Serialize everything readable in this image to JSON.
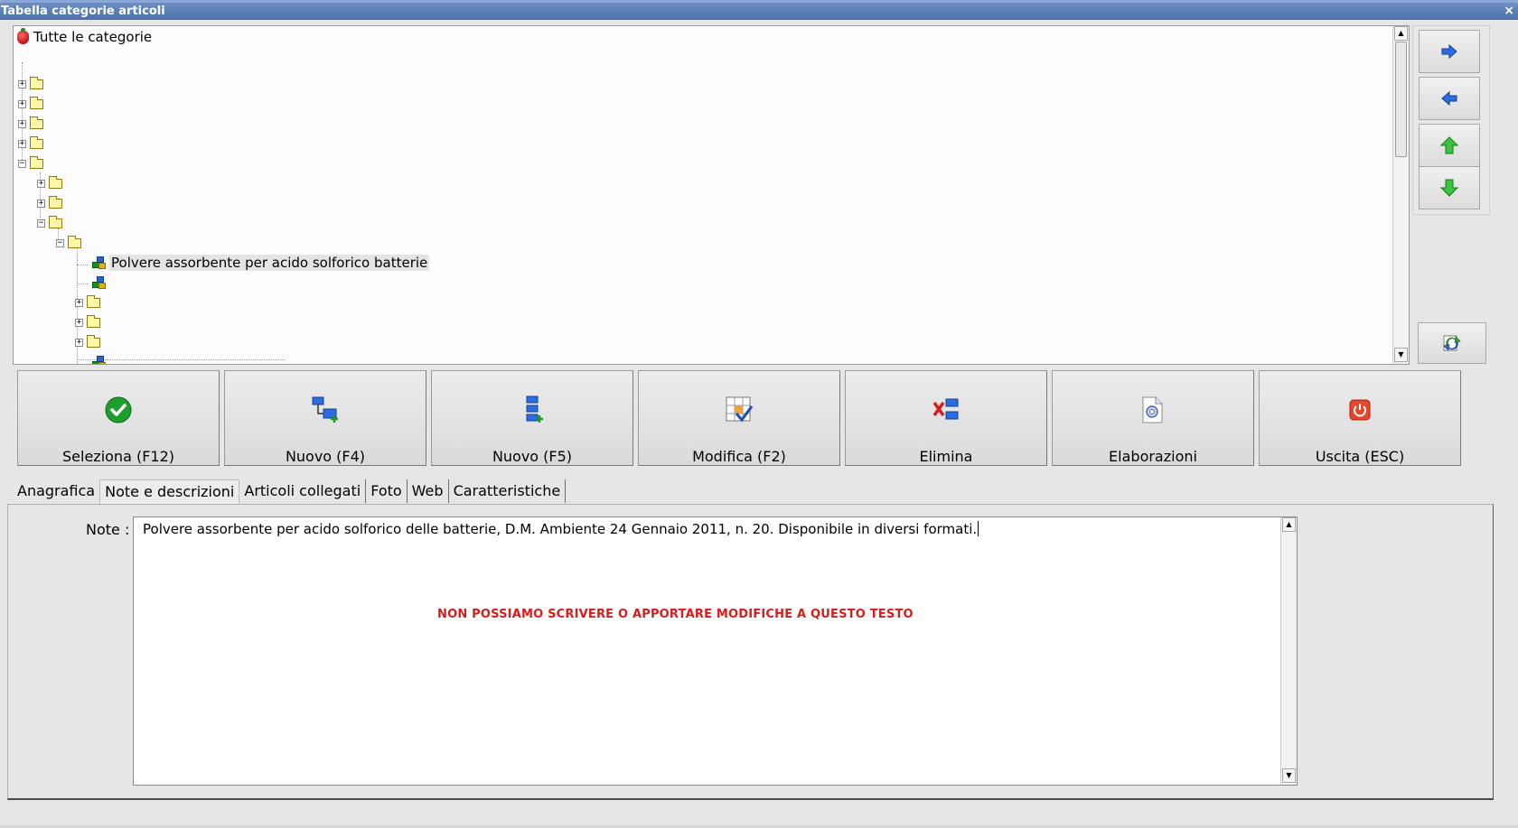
{
  "window": {
    "title": "Tabella categorie articoli",
    "close_label": "×"
  },
  "tree": {
    "root_label": "Tutte le categorie",
    "selected_item_label": "Polvere assorbente per acido solforico batterie"
  },
  "side_buttons": {
    "right_arrow_icon": "arrow-right-icon",
    "left_arrow_icon": "arrow-left-icon",
    "up_arrow_icon": "arrow-up-icon",
    "down_arrow_icon": "arrow-down-icon",
    "refresh_icon": "refresh-icon"
  },
  "toolbar": {
    "seleziona": "Seleziona (F12)",
    "nuovo_f4": "Nuovo (F4)",
    "nuovo_f5": "Nuovo (F5)",
    "modifica": "Modifica (F2)",
    "elimina": "Elimina",
    "elaborazioni": "Elaborazioni",
    "uscita": "Uscita (ESC)"
  },
  "tabs": [
    {
      "label": "Anagrafica"
    },
    {
      "label": "Note e descrizioni"
    },
    {
      "label": "Articoli collegati"
    },
    {
      "label": "Foto"
    },
    {
      "label": "Web"
    },
    {
      "label": "Caratteristiche"
    }
  ],
  "notes": {
    "label": "Note :",
    "text": "Polvere assorbente per acido solforico delle batterie, D.M. Ambiente 24 Gennaio 2011, n. 20. Disponibile in diversi formati.",
    "warning": "NON POSSIAMO SCRIVERE O APPORTARE MODIFICHE A QUESTO TESTO"
  },
  "colors": {
    "titlebar": "#4b6fa8",
    "warning": "#d81b1b",
    "arrow_blue": "#1f5fd6",
    "arrow_green": "#2fae2f"
  }
}
